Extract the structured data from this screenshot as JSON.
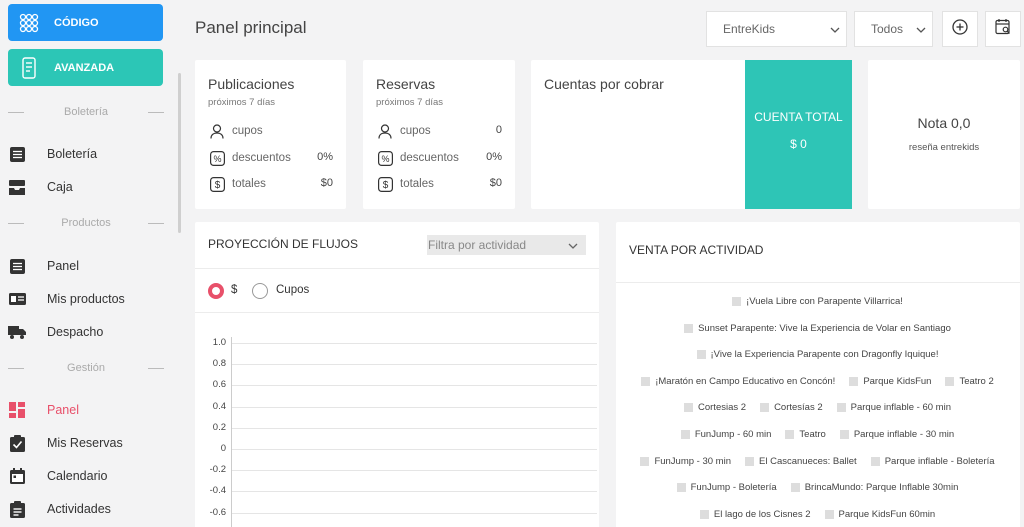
{
  "sidebar": {
    "codigo_label": "CÓDIGO",
    "avanzada_label": "AVANZADA",
    "sections": {
      "boleteria": "Boletería",
      "productos": "Productos",
      "gestion": "Gestión"
    },
    "items": {
      "boleteria": "Boletería",
      "caja": "Caja",
      "panel_productos": "Panel",
      "mis_productos": "Mis productos",
      "despacho": "Despacho",
      "panel_gestion": "Panel",
      "mis_reservas": "Mis Reservas",
      "calendario": "Calendario",
      "actividades": "Actividades"
    },
    "active_color": "#e8506a"
  },
  "header": {
    "title": "Panel principal",
    "company_select": "EntreKids",
    "filter_select": "Todos"
  },
  "publicaciones": {
    "title": "Publicaciones",
    "subtitle": "próximos 7 días",
    "cupos_label": "cupos",
    "cupos_value": "",
    "descuentos_label": "descuentos",
    "descuentos_value": "0%",
    "totales_label": "totales",
    "totales_value": "$0"
  },
  "reservas": {
    "title": "Reservas",
    "subtitle": "próximos 7 días",
    "cupos_label": "cupos",
    "cupos_value": "0",
    "descuentos_label": "descuentos",
    "descuentos_value": "0%",
    "totales_label": "totales",
    "totales_value": "$0"
  },
  "cuentas": {
    "title": "Cuentas por cobrar",
    "total_label": "CUENTA TOTAL",
    "total_value": "$ 0",
    "accent": "#2ec5b6"
  },
  "nota": {
    "value": "Nota 0,0",
    "label": "reseña entrekids"
  },
  "proyeccion": {
    "title": "PROYECCIÓN DE FLUJOS",
    "filter_placeholder": "Filtra por actividad",
    "radio_money": "$",
    "radio_cupos": "Cupos",
    "selected": "$"
  },
  "chart_data": {
    "type": "line",
    "title": "",
    "yticks": [
      "1.0",
      "0.8",
      "0.6",
      "0.4",
      "0.2",
      "0",
      "-0.2",
      "-0.4",
      "-0.6"
    ],
    "ylim": [
      -0.6,
      1.0
    ],
    "series": []
  },
  "venta": {
    "title": "VENTA POR ACTIVIDAD",
    "legend_rows": [
      [
        "¡Vuela Libre con Parapente Villarrica!"
      ],
      [
        "Sunset Parapente: Vive la Experiencia de Volar en Santiago"
      ],
      [
        "¡Vive la Experiencia Parapente con Dragonfly Iquique!"
      ],
      [
        "¡Maratón en Campo Educativo en Concón!",
        "Parque KidsFun",
        "Teatro 2"
      ],
      [
        "Cortesias 2",
        "Cortesías 2",
        "Parque inflable - 60 min"
      ],
      [
        "FunJump - 60 min",
        "Teatro",
        "Parque inflable - 30 min"
      ],
      [
        "FunJump - 30 min",
        "El Cascanueces: Ballet",
        "Parque inflable - Boletería"
      ],
      [
        "FunJump - Boletería",
        "BrincaMundo: Parque Inflable 30min"
      ],
      [
        "El lago de los Cisnes 2",
        "Parque KidsFun 60min"
      ]
    ]
  }
}
